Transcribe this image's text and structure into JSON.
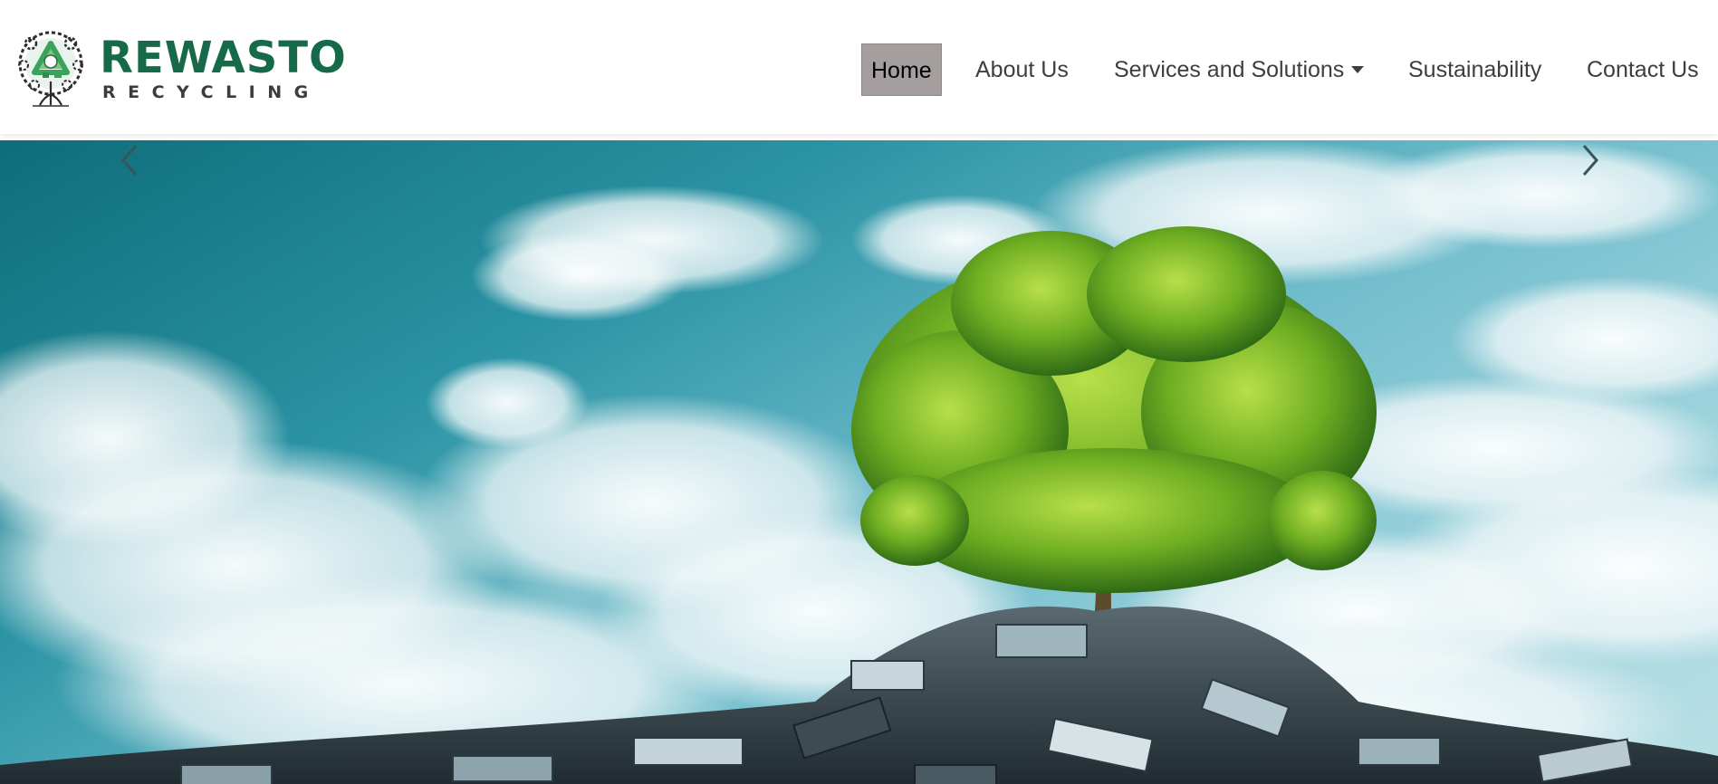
{
  "brand": {
    "name": "REWASTO",
    "tagline": "RECYCLING",
    "primary_color": "#166a4a",
    "secondary_color": "#3c3c3c"
  },
  "nav": {
    "items": [
      {
        "label": "Home",
        "active": true
      },
      {
        "label": "About Us",
        "active": false
      },
      {
        "label": "Services and Solutions",
        "active": false,
        "has_dropdown": true
      },
      {
        "label": "Sustainability",
        "active": false
      },
      {
        "label": "Contact Us",
        "active": false
      }
    ],
    "active_bg": "#a49e9f"
  },
  "hero": {
    "image": "tree-on-e-waste-pile",
    "prev_icon": "chevron-left-icon",
    "next_icon": "chevron-right-icon"
  }
}
